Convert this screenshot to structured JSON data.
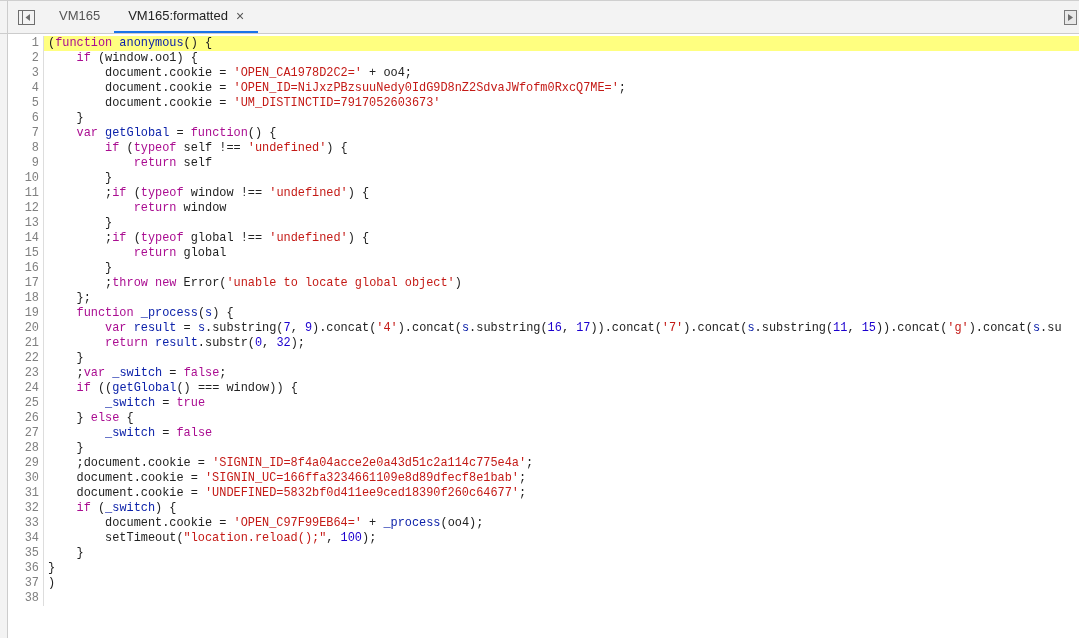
{
  "tabs": [
    {
      "label": "VM165",
      "selected": false
    },
    {
      "label": "VM165:formatted",
      "selected": true,
      "close_glyph": "×"
    }
  ],
  "editor": {
    "lines": [
      {
        "number": "1",
        "highlighted": true,
        "tokens": [
          {
            "kind": "plain",
            "text": "("
          },
          {
            "kind": "keyword",
            "text": "function"
          },
          {
            "kind": "name",
            "text": " anonymous"
          },
          {
            "kind": "plain",
            "text": "() {"
          }
        ]
      },
      {
        "number": "2",
        "highlighted": false,
        "tokens": [
          {
            "kind": "keyword",
            "text": "    if"
          },
          {
            "kind": "plain",
            "text": " (window.oo1) {"
          }
        ]
      },
      {
        "number": "3",
        "highlighted": false,
        "tokens": [
          {
            "kind": "plain",
            "text": "        document.cookie = "
          },
          {
            "kind": "string",
            "text": "'OPEN_CA1978D2C2='"
          },
          {
            "kind": "plain",
            "text": " + oo4;"
          }
        ]
      },
      {
        "number": "4",
        "highlighted": false,
        "tokens": [
          {
            "kind": "plain",
            "text": "        document.cookie = "
          },
          {
            "kind": "string",
            "text": "'OPEN_ID=NiJxzPBzsuuNedy0IdG9D8nZ2SdvaJWfofm0RxcQ7ME='"
          },
          {
            "kind": "plain",
            "text": ";"
          }
        ]
      },
      {
        "number": "5",
        "highlighted": false,
        "tokens": [
          {
            "kind": "plain",
            "text": "        document.cookie = "
          },
          {
            "kind": "string",
            "text": "'UM_DISTINCTID=7917052603673'"
          }
        ]
      },
      {
        "number": "6",
        "highlighted": false,
        "tokens": [
          {
            "kind": "plain",
            "text": "    }"
          }
        ]
      },
      {
        "number": "7",
        "highlighted": false,
        "tokens": [
          {
            "kind": "keyword",
            "text": "    var"
          },
          {
            "kind": "name",
            "text": " getGlobal"
          },
          {
            "kind": "plain",
            "text": " = "
          },
          {
            "kind": "keyword",
            "text": "function"
          },
          {
            "kind": "plain",
            "text": "() {"
          }
        ]
      },
      {
        "number": "8",
        "highlighted": false,
        "tokens": [
          {
            "kind": "keyword",
            "text": "        if"
          },
          {
            "kind": "plain",
            "text": " ("
          },
          {
            "kind": "keyword",
            "text": "typeof"
          },
          {
            "kind": "plain",
            "text": " self !== "
          },
          {
            "kind": "string",
            "text": "'undefined'"
          },
          {
            "kind": "plain",
            "text": ") {"
          }
        ]
      },
      {
        "number": "9",
        "highlighted": false,
        "tokens": [
          {
            "kind": "keyword",
            "text": "            return"
          },
          {
            "kind": "plain",
            "text": " self"
          }
        ]
      },
      {
        "number": "10",
        "highlighted": false,
        "tokens": [
          {
            "kind": "plain",
            "text": "        }"
          }
        ]
      },
      {
        "number": "11",
        "highlighted": false,
        "tokens": [
          {
            "kind": "plain",
            "text": "        ;"
          },
          {
            "kind": "keyword",
            "text": "if"
          },
          {
            "kind": "plain",
            "text": " ("
          },
          {
            "kind": "keyword",
            "text": "typeof"
          },
          {
            "kind": "plain",
            "text": " window !== "
          },
          {
            "kind": "string",
            "text": "'undefined'"
          },
          {
            "kind": "plain",
            "text": ") {"
          }
        ]
      },
      {
        "number": "12",
        "highlighted": false,
        "tokens": [
          {
            "kind": "keyword",
            "text": "            return"
          },
          {
            "kind": "plain",
            "text": " window"
          }
        ]
      },
      {
        "number": "13",
        "highlighted": false,
        "tokens": [
          {
            "kind": "plain",
            "text": "        }"
          }
        ]
      },
      {
        "number": "14",
        "highlighted": false,
        "tokens": [
          {
            "kind": "plain",
            "text": "        ;"
          },
          {
            "kind": "keyword",
            "text": "if"
          },
          {
            "kind": "plain",
            "text": " ("
          },
          {
            "kind": "keyword",
            "text": "typeof"
          },
          {
            "kind": "plain",
            "text": " global !== "
          },
          {
            "kind": "string",
            "text": "'undefined'"
          },
          {
            "kind": "plain",
            "text": ") {"
          }
        ]
      },
      {
        "number": "15",
        "highlighted": false,
        "tokens": [
          {
            "kind": "keyword",
            "text": "            return"
          },
          {
            "kind": "plain",
            "text": " global"
          }
        ]
      },
      {
        "number": "16",
        "highlighted": false,
        "tokens": [
          {
            "kind": "plain",
            "text": "        }"
          }
        ]
      },
      {
        "number": "17",
        "highlighted": false,
        "tokens": [
          {
            "kind": "plain",
            "text": "        ;"
          },
          {
            "kind": "keyword",
            "text": "throw"
          },
          {
            "kind": "keyword",
            "text": " new"
          },
          {
            "kind": "plain",
            "text": " Error("
          },
          {
            "kind": "string",
            "text": "'unable to locate global object'"
          },
          {
            "kind": "plain",
            "text": ")"
          }
        ]
      },
      {
        "number": "18",
        "highlighted": false,
        "tokens": [
          {
            "kind": "plain",
            "text": "    };"
          }
        ]
      },
      {
        "number": "19",
        "highlighted": false,
        "tokens": [
          {
            "kind": "keyword",
            "text": "    function"
          },
          {
            "kind": "name",
            "text": " _process"
          },
          {
            "kind": "plain",
            "text": "("
          },
          {
            "kind": "name",
            "text": "s"
          },
          {
            "kind": "plain",
            "text": ") {"
          }
        ]
      },
      {
        "number": "20",
        "highlighted": false,
        "tokens": [
          {
            "kind": "keyword",
            "text": "        var"
          },
          {
            "kind": "name",
            "text": " result"
          },
          {
            "kind": "plain",
            "text": " = "
          },
          {
            "kind": "name",
            "text": "s"
          },
          {
            "kind": "plain",
            "text": ".substring("
          },
          {
            "kind": "number",
            "text": "7"
          },
          {
            "kind": "plain",
            "text": ", "
          },
          {
            "kind": "number",
            "text": "9"
          },
          {
            "kind": "plain",
            "text": ").concat("
          },
          {
            "kind": "string",
            "text": "'4'"
          },
          {
            "kind": "plain",
            "text": ").concat("
          },
          {
            "kind": "name",
            "text": "s"
          },
          {
            "kind": "plain",
            "text": ".substring("
          },
          {
            "kind": "number",
            "text": "16"
          },
          {
            "kind": "plain",
            "text": ", "
          },
          {
            "kind": "number",
            "text": "17"
          },
          {
            "kind": "plain",
            "text": ")).concat("
          },
          {
            "kind": "string",
            "text": "'7'"
          },
          {
            "kind": "plain",
            "text": ").concat("
          },
          {
            "kind": "name",
            "text": "s"
          },
          {
            "kind": "plain",
            "text": ".substring("
          },
          {
            "kind": "number",
            "text": "11"
          },
          {
            "kind": "plain",
            "text": ", "
          },
          {
            "kind": "number",
            "text": "15"
          },
          {
            "kind": "plain",
            "text": ")).concat("
          },
          {
            "kind": "string",
            "text": "'g'"
          },
          {
            "kind": "plain",
            "text": ").concat("
          },
          {
            "kind": "name",
            "text": "s"
          },
          {
            "kind": "plain",
            "text": ".su"
          }
        ]
      },
      {
        "number": "21",
        "highlighted": false,
        "tokens": [
          {
            "kind": "keyword",
            "text": "        return"
          },
          {
            "kind": "name",
            "text": " result"
          },
          {
            "kind": "plain",
            "text": ".substr("
          },
          {
            "kind": "number",
            "text": "0"
          },
          {
            "kind": "plain",
            "text": ", "
          },
          {
            "kind": "number",
            "text": "32"
          },
          {
            "kind": "plain",
            "text": ");"
          }
        ]
      },
      {
        "number": "22",
        "highlighted": false,
        "tokens": [
          {
            "kind": "plain",
            "text": "    }"
          }
        ]
      },
      {
        "number": "23",
        "highlighted": false,
        "tokens": [
          {
            "kind": "plain",
            "text": "    ;"
          },
          {
            "kind": "keyword",
            "text": "var"
          },
          {
            "kind": "name",
            "text": " _switch"
          },
          {
            "kind": "plain",
            "text": " = "
          },
          {
            "kind": "keyword",
            "text": "false"
          },
          {
            "kind": "plain",
            "text": ";"
          }
        ]
      },
      {
        "number": "24",
        "highlighted": false,
        "tokens": [
          {
            "kind": "keyword",
            "text": "    if"
          },
          {
            "kind": "plain",
            "text": " (("
          },
          {
            "kind": "name",
            "text": "getGlobal"
          },
          {
            "kind": "plain",
            "text": "() === window)) {"
          }
        ]
      },
      {
        "number": "25",
        "highlighted": false,
        "tokens": [
          {
            "kind": "name",
            "text": "        _switch"
          },
          {
            "kind": "plain",
            "text": " = "
          },
          {
            "kind": "keyword",
            "text": "true"
          }
        ]
      },
      {
        "number": "26",
        "highlighted": false,
        "tokens": [
          {
            "kind": "plain",
            "text": "    } "
          },
          {
            "kind": "keyword",
            "text": "else"
          },
          {
            "kind": "plain",
            "text": " {"
          }
        ]
      },
      {
        "number": "27",
        "highlighted": false,
        "tokens": [
          {
            "kind": "name",
            "text": "        _switch"
          },
          {
            "kind": "plain",
            "text": " = "
          },
          {
            "kind": "keyword",
            "text": "false"
          }
        ]
      },
      {
        "number": "28",
        "highlighted": false,
        "tokens": [
          {
            "kind": "plain",
            "text": "    }"
          }
        ]
      },
      {
        "number": "29",
        "highlighted": false,
        "tokens": [
          {
            "kind": "plain",
            "text": "    ;document.cookie = "
          },
          {
            "kind": "string",
            "text": "'SIGNIN_ID=8f4a04acce2e0a43d51c2a114c775e4a'"
          },
          {
            "kind": "plain",
            "text": ";"
          }
        ]
      },
      {
        "number": "30",
        "highlighted": false,
        "tokens": [
          {
            "kind": "plain",
            "text": "    document.cookie = "
          },
          {
            "kind": "string",
            "text": "'SIGNIN_UC=166ffa3234661109e8d89dfecf8e1bab'"
          },
          {
            "kind": "plain",
            "text": ";"
          }
        ]
      },
      {
        "number": "31",
        "highlighted": false,
        "tokens": [
          {
            "kind": "plain",
            "text": "    document.cookie = "
          },
          {
            "kind": "string",
            "text": "'UNDEFINED=5832bf0d411ee9ced18390f260c64677'"
          },
          {
            "kind": "plain",
            "text": ";"
          }
        ]
      },
      {
        "number": "32",
        "highlighted": false,
        "tokens": [
          {
            "kind": "keyword",
            "text": "    if"
          },
          {
            "kind": "plain",
            "text": " ("
          },
          {
            "kind": "name",
            "text": "_switch"
          },
          {
            "kind": "plain",
            "text": ") {"
          }
        ]
      },
      {
        "number": "33",
        "highlighted": false,
        "tokens": [
          {
            "kind": "plain",
            "text": "        document.cookie = "
          },
          {
            "kind": "string",
            "text": "'OPEN_C97F99EB64='"
          },
          {
            "kind": "plain",
            "text": " + "
          },
          {
            "kind": "name",
            "text": "_process"
          },
          {
            "kind": "plain",
            "text": "(oo4);"
          }
        ]
      },
      {
        "number": "34",
        "highlighted": false,
        "tokens": [
          {
            "kind": "plain",
            "text": "        setTimeout("
          },
          {
            "kind": "string",
            "text": "\"location.reload();\""
          },
          {
            "kind": "plain",
            "text": ", "
          },
          {
            "kind": "number",
            "text": "100"
          },
          {
            "kind": "plain",
            "text": ");"
          }
        ]
      },
      {
        "number": "35",
        "highlighted": false,
        "tokens": [
          {
            "kind": "plain",
            "text": "    }"
          }
        ]
      },
      {
        "number": "36",
        "highlighted": false,
        "tokens": [
          {
            "kind": "plain",
            "text": "}"
          }
        ]
      },
      {
        "number": "37",
        "highlighted": false,
        "tokens": [
          {
            "kind": "plain",
            "text": ")"
          }
        ]
      },
      {
        "number": "38",
        "highlighted": false
      }
    ]
  }
}
